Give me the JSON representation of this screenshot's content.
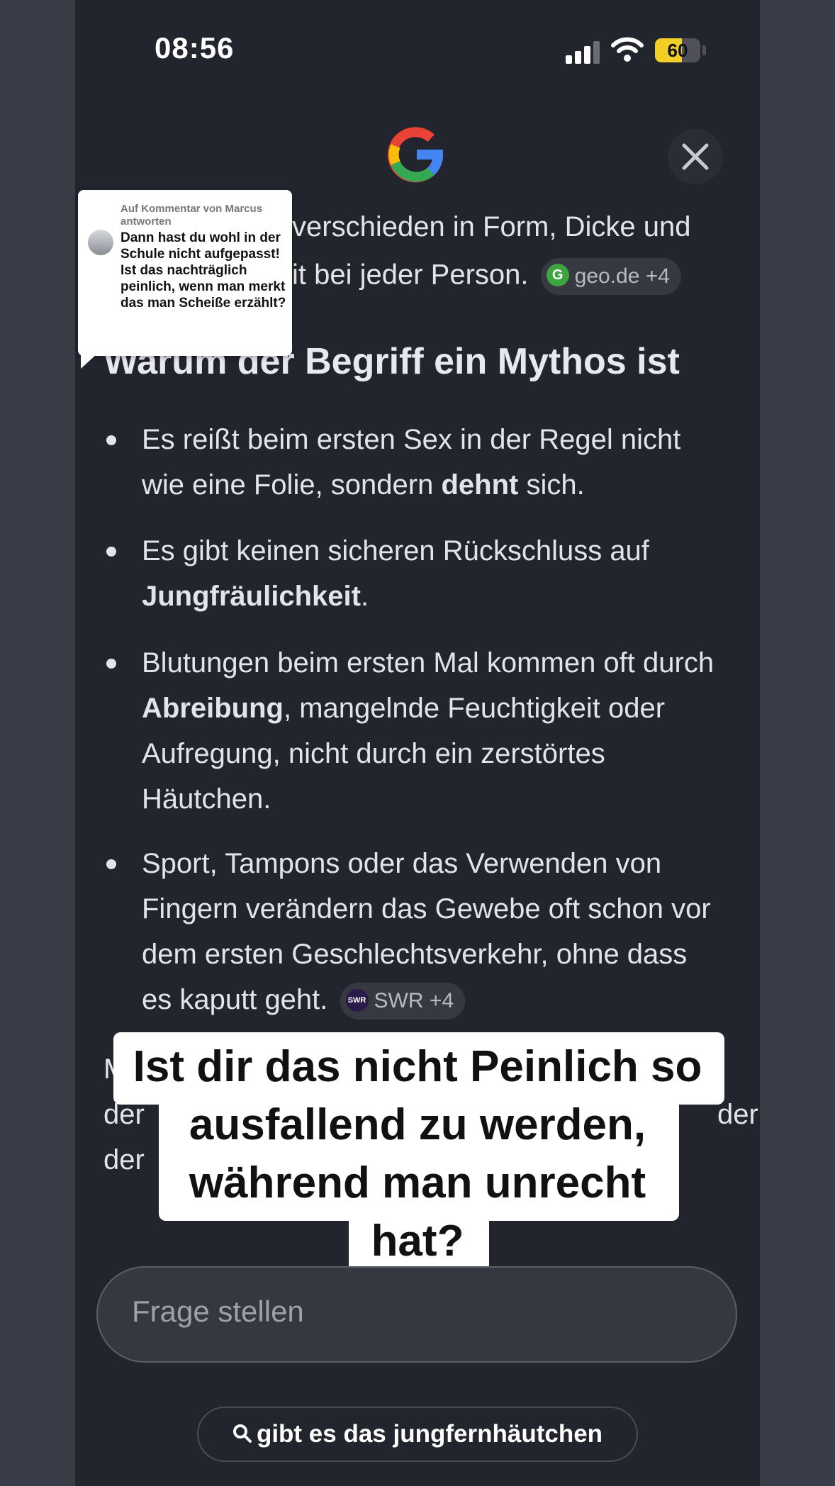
{
  "status": {
    "time": "08:56",
    "battery": "60"
  },
  "answer": {
    "line_top_1": "verschieden in Form, Dicke und",
    "line_top_2": "it bei jeder Person.",
    "chip_geo": "geo.de +4",
    "heading": "Warum der Begriff ein Mythos ist",
    "bullets": [
      {
        "pre": "Es reißt beim ersten Sex in der Regel nicht wie eine Folie, sondern ",
        "bold": "dehnt",
        "post": " sich."
      },
      {
        "pre": "Es gibt keinen sicheren Rückschluss auf ",
        "bold": "Jungfräulichkeit",
        "post": "."
      },
      {
        "pre": "Blutungen beim ersten Mal kommen oft durch ",
        "bold": "Abreibung",
        "post": ", mangelnde Feuchtigkeit oder Aufregung, nicht durch ein zerstörtes Häutchen."
      },
      {
        "pre": "Sport, Tampons oder das Verwenden von Fingern verändern das Gewebe oft schon vor dem ersten Geschlechtsverkehr, ohne dass es kaputt geht.",
        "bold": "",
        "post": ""
      }
    ],
    "chip_swr": "SWR +4",
    "partial_1": "M",
    "partial_2_left": "der",
    "partial_2_right": "der",
    "partial_3": "der"
  },
  "reply": {
    "header": "Auf Kommentar von Marcus antworten",
    "text": "Dann hast du wohl in der Schule nicht aufgepasst! Ist das nachträglich peinlich, wenn man merkt das man Scheiße erzählt?"
  },
  "caption": {
    "line1": "Ist dir das nicht Peinlich so",
    "line2": "ausfallend zu werden,",
    "line3": "während man unrecht",
    "line4": "hat?"
  },
  "input": {
    "placeholder": "Frage stellen"
  },
  "search_query": "gibt es das jungfernhäutchen",
  "colors": {
    "background": "#23252e",
    "text": "#e3e4ea",
    "battery": "#f2cf26"
  }
}
